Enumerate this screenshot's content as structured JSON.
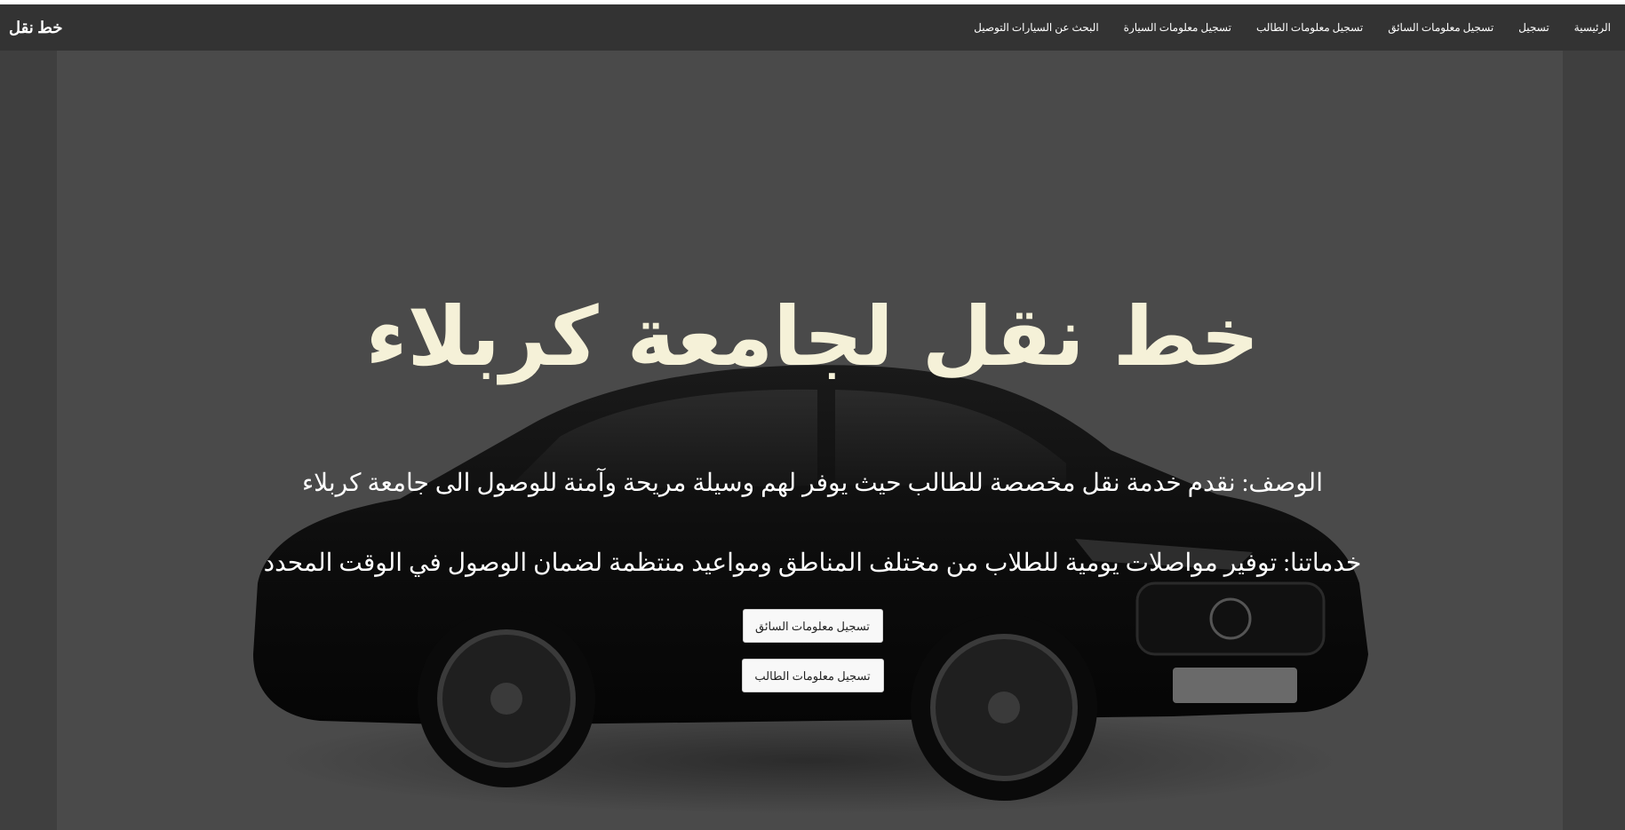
{
  "navbar": {
    "brand": "خط نقل",
    "links": [
      "الرئيسية",
      "تسجيل",
      "تسجيل معلومات السائق",
      "تسجيل معلومات الطالب",
      "تسجيل معلومات السيارة",
      "البحث عن السيارات التوصيل"
    ]
  },
  "hero": {
    "title": "خط نقل لجامعة كربلاء",
    "description": "الوصف: نقدم خدمة نقل مخصصة للطالب حيث يوفر لهم وسيلة مريحة وآمنة للوصول الى جامعة كربلاء",
    "services": "خدماتنا: توفير مواصلات يومية للطلاب من مختلف المناطق ومواعيد منتظمة لضمان الوصول في الوقت المحدد",
    "driver_button": "تسجيل معلومات السائق",
    "student_button": "تسجيل معلومات الطالب",
    "background_image": "car-image"
  },
  "colors": {
    "navbar_bg": "#333333",
    "hero_overlay": "#4a4a4a",
    "title_color": "#f5f1d8"
  }
}
